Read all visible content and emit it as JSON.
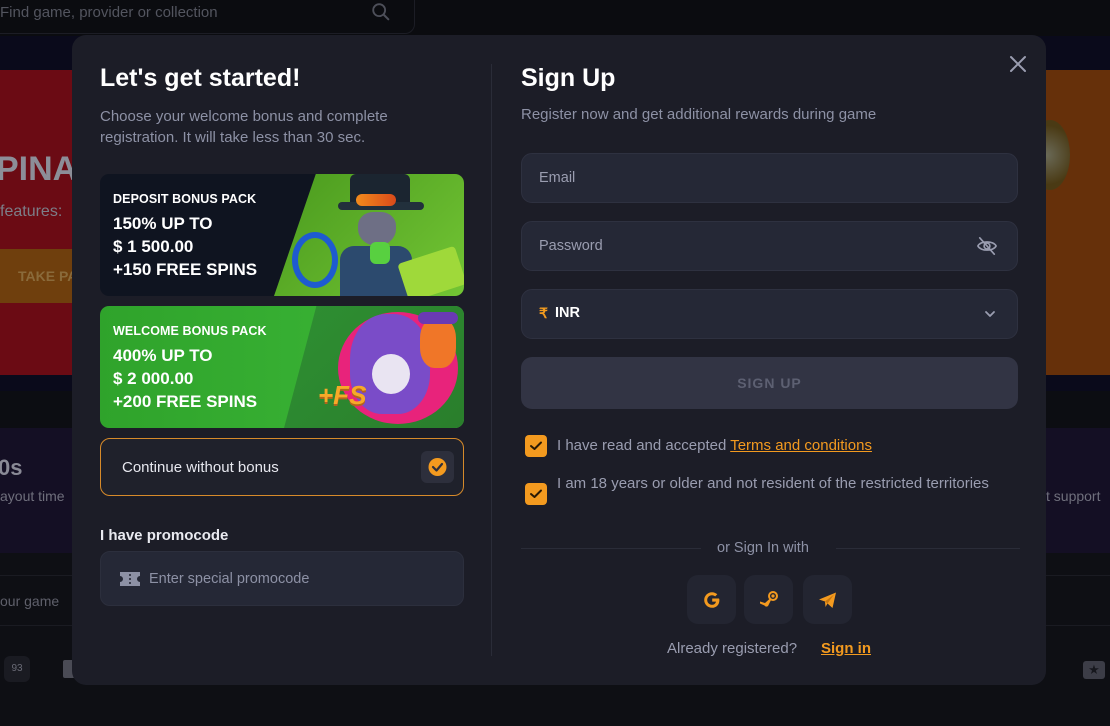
{
  "background": {
    "search_placeholder": "Find game, provider or collection",
    "promo_title_fragment": "PINAR",
    "promo_sub_fragment": "features:",
    "promo_button_fragment": "TAKE PA",
    "stat_value_fragment": "0s",
    "stat_label_fragment": "ayout time",
    "stat_label_right_fragment": "t support",
    "find_game_fragment": "our game",
    "count_badge": "93"
  },
  "modal": {
    "left": {
      "title": "Let's get started!",
      "subtitle": "Choose your welcome bonus and complete registration. It will take less than 30 sec.",
      "bonuses": [
        {
          "kicker": "DEPOSIT BONUS PACK",
          "line1": "150% UP TO",
          "line2": "$ 1 500.00",
          "line3": "+150 FREE SPINS"
        },
        {
          "kicker": "WELCOME BONUS PACK",
          "line1": "400% UP TO",
          "line2": "$ 2 000.00",
          "line3": "+200 FREE SPINS",
          "badge": "+FS"
        }
      ],
      "continue_label": "Continue without bonus",
      "continue_selected": true,
      "promo_label": "I have promocode",
      "promo_placeholder": "Enter special promocode"
    },
    "right": {
      "title": "Sign Up",
      "subtitle": "Register now and get additional rewards during game",
      "email_placeholder": "Email",
      "password_placeholder": "Password",
      "currency_symbol": "₹",
      "currency_value": "INR",
      "signup_label": "SIGN UP",
      "terms_prefix": "I have read and accepted ",
      "terms_link": "Terms and conditions",
      "terms_checked": true,
      "age_text": "I am 18 years or older and not resident of the restricted territories",
      "age_checked": true,
      "or_sign_in_with": "or Sign In with",
      "social_providers": [
        "Google",
        "Steam",
        "Telegram"
      ],
      "already_registered": "Already registered?",
      "sign_in_link": "Sign in"
    },
    "accent_color": "#f39a1f"
  }
}
